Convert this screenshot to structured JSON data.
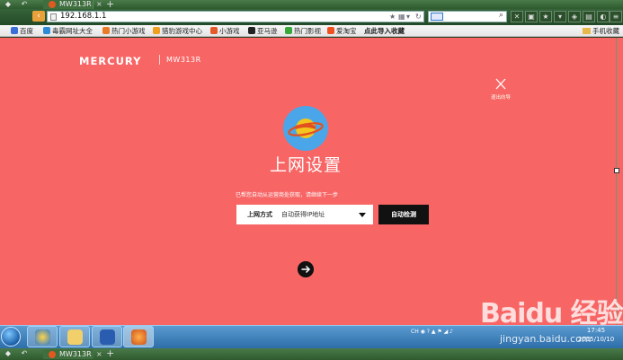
{
  "browser": {
    "tab_title": "MW313R",
    "address": "192.168.1.1",
    "tab_close": "×",
    "tab_new": "+",
    "back_glyph": "‹"
  },
  "bookmarks": [
    {
      "label": "百度",
      "color": "#3a6fd8"
    },
    {
      "label": "毒霸网址大全",
      "color": "#2e8bd6"
    },
    {
      "label": "热门小游戏",
      "color": "#e87a28"
    },
    {
      "label": "猎豹游戏中心",
      "color": "#f0a020"
    },
    {
      "label": "小游戏",
      "color": "#e65a2a"
    },
    {
      "label": "亚马逊",
      "color": "#222222"
    },
    {
      "label": "热门影视",
      "color": "#38a83a"
    },
    {
      "label": "爱淘宝",
      "color": "#f05020"
    }
  ],
  "bookmark_import": "点此导入收藏",
  "bookmark_folder": "手机收藏",
  "router": {
    "brand": "MERCURY",
    "model": "MW313R",
    "exit_label": "退出向导",
    "title": "上网设置",
    "hint": "已帮您自动从运营商处获取，请继续下一步",
    "connection": {
      "label": "上网方式",
      "value": "自动获得IP地址"
    },
    "auto_detect_label": "自动检测"
  },
  "taskbar": {
    "clock_time": "17:45",
    "clock_date": "2015/10/10",
    "tray_text": "CH",
    "watermark": "Baidu 经验",
    "watermark_sub": "jingyan.baidu.com"
  },
  "colors": {
    "page_bg": "#f86565",
    "button_dark": "#111111",
    "accent_blue": "#4aa6e8"
  }
}
